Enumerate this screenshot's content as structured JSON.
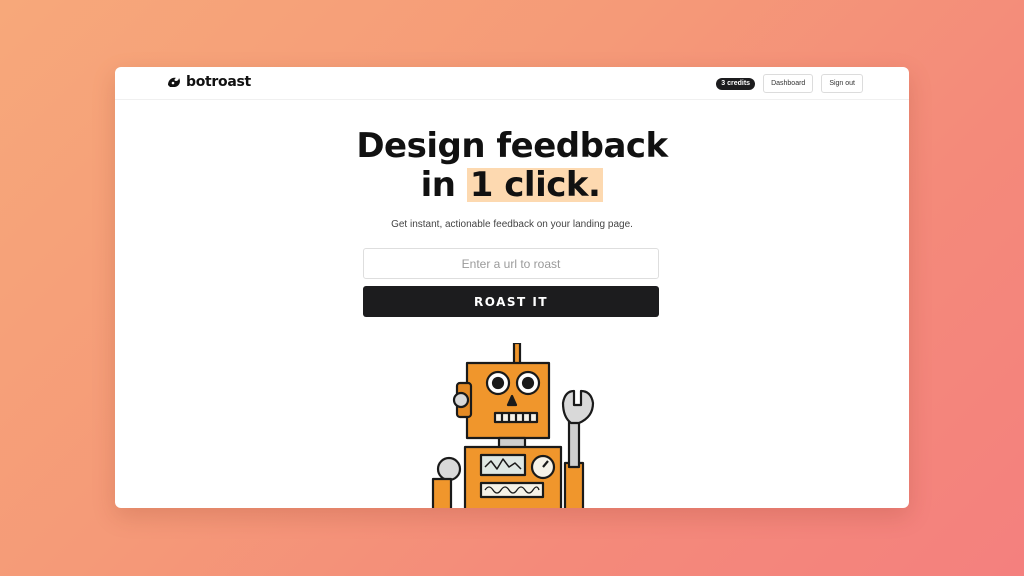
{
  "app": {
    "name": "botroast"
  },
  "nav": {
    "credits": "3 credits",
    "dashboard": "Dashboard",
    "signout": "Sign out"
  },
  "hero": {
    "line1": "Design feedback",
    "line2_prefix": "in ",
    "line2_highlight": "1 click.",
    "subtitle": "Get instant, actionable feedback on your landing page."
  },
  "form": {
    "placeholder": "Enter a url to roast",
    "value": "",
    "button": "ROAST IT"
  },
  "colors": {
    "accent_highlight": "#fdd9b0",
    "button_bg": "#1c1c1e",
    "robot_orange": "#f0962c"
  }
}
